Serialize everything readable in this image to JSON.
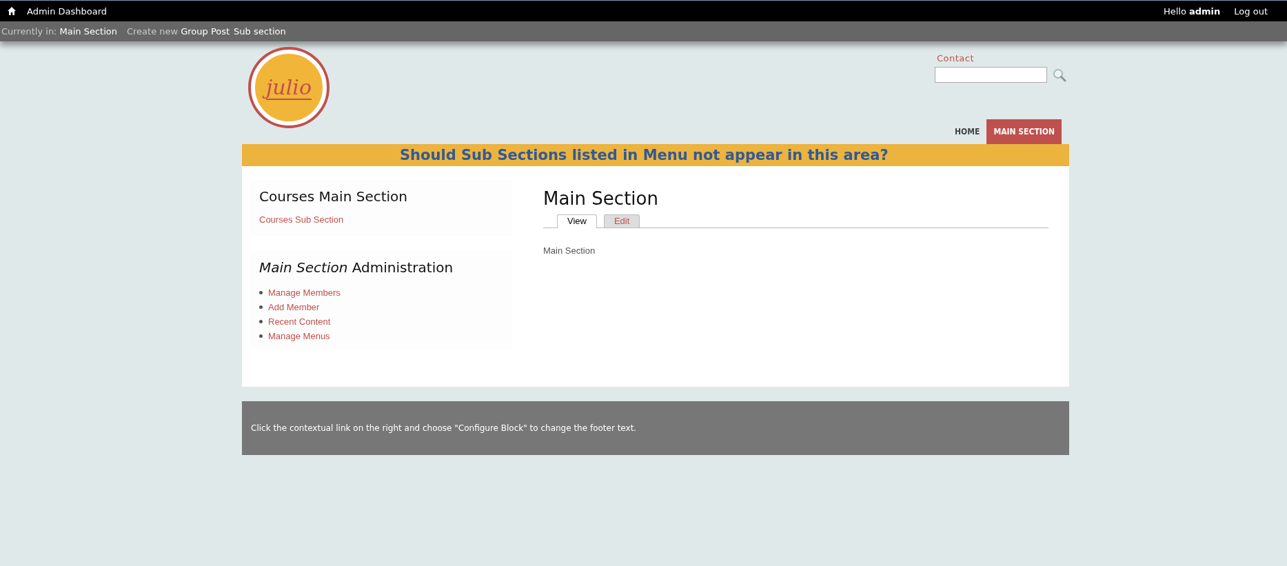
{
  "admin_bar": {
    "left": [
      {
        "label": "Admin Dashboard"
      }
    ],
    "greeting": "Hello **admin**",
    "logout": "Log out"
  },
  "context_bar": {
    "prefix": "Currently in:",
    "current": "Main Section",
    "create_label": "Create new",
    "create_links": [
      "Group Post",
      "Sub section"
    ]
  },
  "header": {
    "logo_text": "julio",
    "contact": "Contact"
  },
  "nav": [
    {
      "label": "HOME",
      "selected": false
    },
    {
      "label": "MAIN SECTION",
      "selected": true
    }
  ],
  "banner": "Should Sub Sections listed in Menu not appear in this area?",
  "sidebar": [
    {
      "title": "Courses Main Section",
      "kind": "plain",
      "links": [
        "Courses Sub Section"
      ]
    },
    {
      "title": "*Main Section* Administration",
      "kind": "bullets",
      "links": [
        "Manage Members",
        "Add Member",
        "Recent Content",
        "Manage Menus"
      ]
    }
  ],
  "main": {
    "title": "Main Section",
    "tabs": [
      {
        "label": "View",
        "selected": true
      },
      {
        "label": "Edit",
        "selected": false
      }
    ],
    "body": "Main Section"
  },
  "footer": "Click the contextual link on the right and choose \"Configure Block\" to change the footer text."
}
